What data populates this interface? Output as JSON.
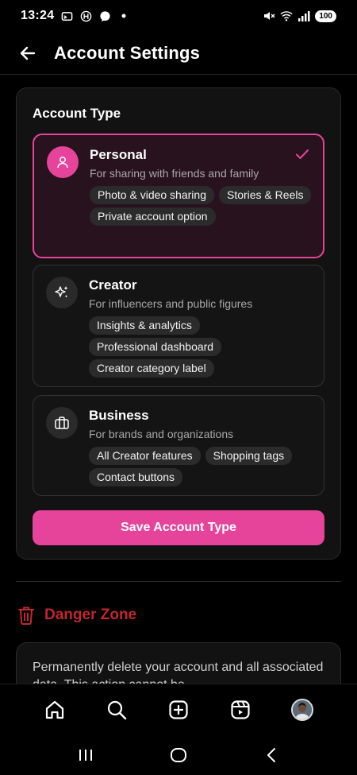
{
  "status_bar": {
    "time": "13:24",
    "battery": "100",
    "left_icons": [
      "cast-icon",
      "hinge-icon",
      "messenger-icon",
      "dot-icon"
    ],
    "right_icons": [
      "mute-icon",
      "wifi-icon",
      "signal-icon"
    ]
  },
  "header": {
    "title": "Account Settings",
    "back_icon": "arrow-left-icon"
  },
  "account_type": {
    "heading": "Account Type",
    "options": [
      {
        "title": "Personal",
        "description": "For sharing with friends and family",
        "icon": "user-icon",
        "selected": true,
        "features": [
          "Photo & video sharing",
          "Stories & Reels",
          "Private account option"
        ]
      },
      {
        "title": "Creator",
        "description": "For influencers and public figures",
        "icon": "sparkles-icon",
        "selected": false,
        "features": [
          "Insights & analytics",
          "Professional dashboard",
          "Creator category label"
        ]
      },
      {
        "title": "Business",
        "description": "For brands and organizations",
        "icon": "briefcase-icon",
        "selected": false,
        "features": [
          "All Creator features",
          "Shopping tags",
          "Contact buttons"
        ]
      }
    ],
    "save_label": "Save Account Type"
  },
  "danger_zone": {
    "title": "Danger Zone",
    "icon": "trash-icon",
    "description": "Permanently delete your account and all associated data. This action cannot be"
  },
  "bottom_nav": {
    "items": [
      "home-icon",
      "search-icon",
      "create-icon",
      "reels-icon",
      "profile-avatar"
    ]
  },
  "system_nav": {
    "items": [
      "recents-icon",
      "home-circle-icon",
      "back-chevron-icon"
    ]
  },
  "colors": {
    "accent": "#e6449a",
    "danger": "#c0272d",
    "background": "#000000",
    "card": "#121212"
  }
}
